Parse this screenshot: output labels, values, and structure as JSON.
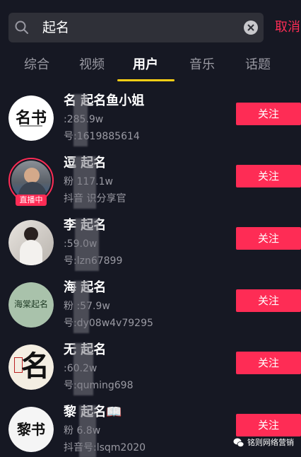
{
  "search": {
    "query": "起名",
    "cancel_label": "取消"
  },
  "tabs": [
    {
      "label": "综合"
    },
    {
      "label": "视频"
    },
    {
      "label": "用户"
    },
    {
      "label": "音乐"
    },
    {
      "label": "话题"
    }
  ],
  "active_tab": "用户",
  "users": [
    {
      "name": "名  起名鱼小姐",
      "fans": "  :285.9w",
      "uid": "   号:1619885614",
      "follow_label": "关注",
      "avatar_text": "名书",
      "live": false
    },
    {
      "name": "逗  起名",
      "fans": "粉   117.1w",
      "uid": "抖音   识分享官",
      "follow_label": "关注",
      "avatar_text": "",
      "live": true,
      "live_label": "直播中"
    },
    {
      "name": "李    起名",
      "fans": "  :59.0w",
      "uid": "   号:lzn67899",
      "follow_label": "关注",
      "avatar_text": "",
      "live": false
    },
    {
      "name": "海  起名",
      "fans": "粉  :57.9w",
      "uid": "   号:dy08w4v79295",
      "follow_label": "关注",
      "avatar_text": "海棠起名",
      "live": false
    },
    {
      "name": "无   起名",
      "fans": "  :60.2w",
      "uid": "   号:quming698",
      "follow_label": "关注",
      "avatar_text": "名",
      "live": false
    },
    {
      "name": "黎   起名📖",
      "fans": "粉  6.8w",
      "uid": "抖音号:lsqm2020",
      "follow_label": "关注",
      "avatar_text": "黎书",
      "live": false
    }
  ],
  "watermark": {
    "text": "铭则网络营销"
  },
  "colors": {
    "accent": "#fe2c55",
    "tab_indicator": "#face15",
    "background": "#161823"
  }
}
